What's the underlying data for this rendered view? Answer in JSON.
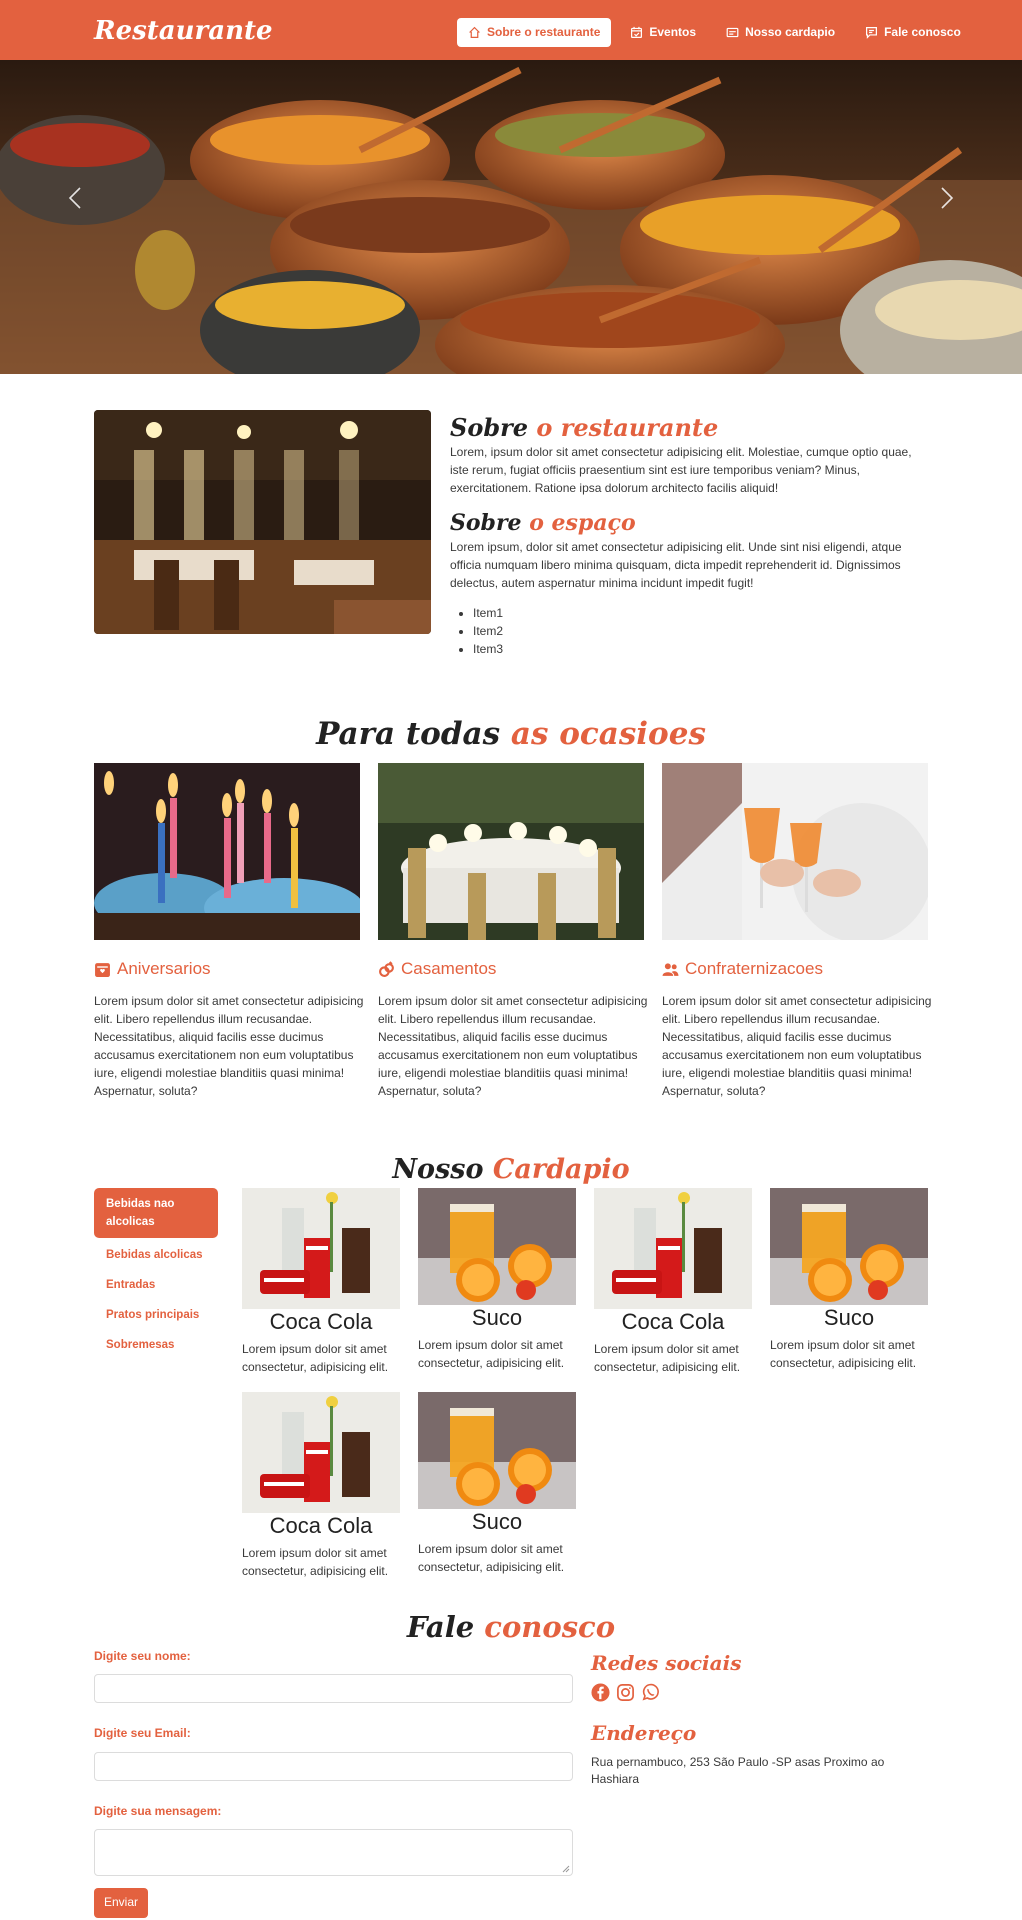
{
  "brand": "Restaurante",
  "nav": [
    {
      "label": "Sobre o restaurante",
      "icon": "home-icon"
    },
    {
      "label": "Eventos",
      "icon": "calendar-check-icon"
    },
    {
      "label": "Nosso cardapio",
      "icon": "card-icon"
    },
    {
      "label": "Fale conosco",
      "icon": "chat-icon"
    }
  ],
  "about": {
    "title1_a": "Sobre",
    "title1_b": "o restaurante",
    "text1": "Lorem, ipsum dolor sit amet consectetur adipisicing elit. Molestiae, cumque optio quae, iste rerum, fugiat officiis praesentium sint est iure temporibus veniam? Minus, exercitationem. Ratione ipsa dolorum architecto facilis aliquid!",
    "title2_a": "Sobre",
    "title2_b": "o espaço",
    "text2": "Lorem ipsum, dolor sit amet consectetur adipisicing elit. Unde sint nisi eligendi, atque officia numquam libero minima quisquam, dicta impedit reprehenderit id. Dignissimos delectus, autem aspernatur minima incidunt impedit fugit!",
    "items": [
      "Item1",
      "Item2",
      "Item3"
    ]
  },
  "occasions": {
    "title_a": "Para todas",
    "title_b": "as ocasioes",
    "cards": [
      {
        "title": "Aniversarios",
        "icon": "gift-calendar-icon",
        "text": "Lorem ipsum dolor sit amet consectetur adipisicing elit. Libero repellendus illum recusandae. Necessitatibus, aliquid facilis esse ducimus accusamus exercitationem non eum voluptatibus iure, eligendi molestiae blanditiis quasi minima! Aspernatur, soluta?"
      },
      {
        "title": "Casamentos",
        "icon": "rings-icon",
        "text": "Lorem ipsum dolor sit amet consectetur adipisicing elit. Libero repellendus illum recusandae. Necessitatibus, aliquid facilis esse ducimus accusamus exercitationem non eum voluptatibus iure, eligendi molestiae blanditiis quasi minima! Aspernatur, soluta?"
      },
      {
        "title": "Confraternizacoes",
        "icon": "people-icon",
        "text": "Lorem ipsum dolor sit amet consectetur adipisicing elit. Libero repellendus illum recusandae. Necessitatibus, aliquid facilis esse ducimus accusamus exercitationem non eum voluptatibus iure, eligendi molestiae blanditiis quasi minima! Aspernatur, soluta?"
      }
    ]
  },
  "menu": {
    "title_a": "Nosso",
    "title_b": "Cardapio",
    "categories": [
      "Bebidas nao alcolicas",
      "Bebidas alcolicas",
      "Entradas",
      "Pratos principais",
      "Sobremesas"
    ],
    "items": [
      {
        "name": "Coca Cola",
        "desc": "Lorem ipsum dolor sit amet consectetur, adipisicing elit."
      },
      {
        "name": "Suco",
        "desc": "Lorem ipsum dolor sit amet consectetur, adipisicing elit."
      },
      {
        "name": "Coca Cola",
        "desc": "Lorem ipsum dolor sit amet consectetur, adipisicing elit."
      },
      {
        "name": "Suco",
        "desc": "Lorem ipsum dolor sit amet consectetur, adipisicing elit."
      },
      {
        "name": "Coca Cola",
        "desc": "Lorem ipsum dolor sit amet consectetur, adipisicing elit."
      },
      {
        "name": "Suco",
        "desc": "Lorem ipsum dolor sit amet consectetur, adipisicing elit."
      }
    ]
  },
  "contact": {
    "title_a": "Fale",
    "title_b": "conosco",
    "name_label": "Digite seu nome:",
    "email_label": "Digite seu Email:",
    "message_label": "Digite sua mensagem:",
    "submit": "Enviar",
    "social_title": "Redes sociais",
    "social_icons": [
      "facebook-icon",
      "instagram-icon",
      "whatsapp-icon"
    ],
    "address_title": "Endereço",
    "address": "Rua pernambuco, 253 São Paulo -SP asas Proximo ao Hashiara"
  },
  "colors": {
    "accent": "#e3613f",
    "text": "#3a3a3a",
    "heading": "#222222"
  }
}
